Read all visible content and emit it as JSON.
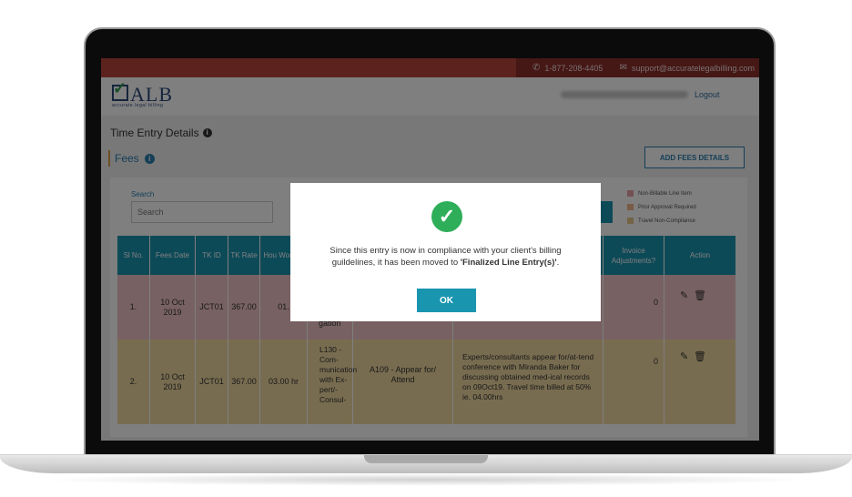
{
  "topbar": {
    "phone": "1-877-208-4405",
    "email": "support@accuratelegalbilling.com",
    "phone_icon": "phone-icon",
    "email_icon": "envelope-icon"
  },
  "header": {
    "logo_text": "ALB",
    "logo_tagline": "accurate legal billing",
    "logout": "Logout"
  },
  "page": {
    "title": "Time Entry Details",
    "tab": "Fees",
    "add_button": "ADD FEES DETAILS"
  },
  "search": {
    "label": "Search",
    "placeholder": "Search"
  },
  "legend": [
    {
      "label": "Non-Billable Line Item",
      "color": "#e8a0a6"
    },
    {
      "label": "Prior Approval Required",
      "color": "#f0b58a"
    },
    {
      "label": "Travel Non-Compliance",
      "color": "#e6c98a"
    }
  ],
  "table": {
    "headers": {
      "sl": "Sl No.",
      "date": "Fees Date",
      "tk_id": "TK ID",
      "tk_rate": "TK Rate",
      "hours": "Hou Worked",
      "invoice_adj": "Invoice Adjustments?",
      "action": "Action"
    },
    "rows": [
      {
        "sl": "1.",
        "date": "10 Oct 2019",
        "tk_id": "JCT01",
        "tk_rate": "367.00",
        "hours": "01.",
        "task_partial": "gation",
        "invoice_adj": "0"
      },
      {
        "sl": "2.",
        "date": "10 Oct 2019",
        "tk_id": "JCT01",
        "tk_rate": "367.00",
        "hours": "03.00 hr",
        "task": "L130 - Com-munication with Ex-pert/-Consul-",
        "activity": "A109 - Appear for/ Attend",
        "description": "Experts/consultants appear for/at-tend conference with Miranda Baker for discussing obtained med-ical records on 09Oct19. Travel time billed at 50% ie. 04.00hrs",
        "invoice_adj": "0"
      }
    ]
  },
  "modal": {
    "message_plain": "Since this entry is now in compliance with your client's billing guildelines, it has been moved to ",
    "message_bold": "'Finalized Line Entry(s)'",
    "message_end": ".",
    "ok": "OK"
  }
}
